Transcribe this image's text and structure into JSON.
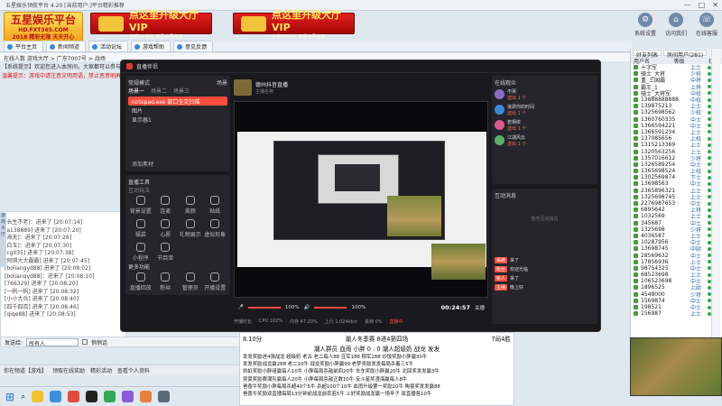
{
  "window": {
    "title": "五星娱乐领航平台 4.20 [当前用户:]平台精彩推荐",
    "controls": [
      "—",
      "□",
      "✕"
    ]
  },
  "logo": {
    "main": "五星娱乐平台",
    "url": "HD.FXT365.COM",
    "slogan": "2018 精彩无限 天天开心"
  },
  "banners": [
    {
      "title": "点这里升级大厅VIP",
      "sub": "全新VIP特权 尊贵会员专享"
    },
    {
      "title": "点这里升级大厅VIP",
      "sub": "全新VIP特权 尊贵会员专享"
    }
  ],
  "right_tools": [
    {
      "label": "系统设置",
      "icon": "gear-icon",
      "glyph": "⚙"
    },
    {
      "label": "访问我们",
      "icon": "home-icon",
      "glyph": "⌂"
    },
    {
      "label": "在线客服",
      "icon": "headset-icon",
      "glyph": "☏"
    }
  ],
  "nav": [
    "平台主页",
    "新闻频道",
    "活动论坛",
    "游戏帮助",
    "意见反馈"
  ],
  "crumb": "在线人数  游戏大厅 > 广东7007号 > 战场",
  "notice1": "【系统提示】欢迎您进入本房间，大家都可以参与游戏，本频道允许大家自由发言和交流，禁止发布广告",
  "notice2": "温馨提示：游戏中请注意文明用语，禁止恶意刷屏和辱骂他人，违者将被封号处理",
  "chat": [
    "[长生不老]：进来了 [20:07:14]",
    "[a138889] 进来了 [20:07:20]",
    "[海天]：进来了 [20:07:26]",
    "[白玉]：进来了 [20:07:30]",
    "[cg035] 进来了 [20:07:38]",
    "[阿琪大大霸霸] 进来了 [20:07:45]",
    "[boliangyd88] 进来了 [20:08:02]",
    "[boliangyd88]：进来了 [20:08:10]",
    "[766329] 进来了 [20:08:20]",
    "[一帆一帆] 进来了 [20:08:32]",
    "[小小大兵] 进来了 [20:08:40]",
    "[四千四百] 进来了 [20:08:46]",
    "[qiqe88] 进来了 [20:08:53]"
  ],
  "sidetab": "游戏大厅",
  "input": {
    "label": "发送给:",
    "target": "所有人",
    "checkbox": "悄悄话"
  },
  "statusbar": [
    "你在频道【游戏】",
    "领取在线奖励",
    "精彩活动",
    "查看个人资料"
  ],
  "rightpanel": {
    "tabs": [
      "好友列表",
      "房间用户(281)"
    ],
    "head": [
      "用户名",
      "等级",
      "状态"
    ],
    "users": [
      {
        "name": "十字军",
        "lv": "上士"
      },
      {
        "name": "骑士_大将",
        "lv": "少校"
      },
      {
        "name": "重_三国霸",
        "lv": "中将"
      },
      {
        "name": "霸王_1",
        "lv": "上将"
      },
      {
        "name": "骑士_大将军",
        "lv": "中校"
      },
      {
        "name": "13888888888",
        "lv": "中校"
      },
      {
        "name": "139875213",
        "lv": "上士"
      },
      {
        "name": "1325698562",
        "lv": "少校"
      },
      {
        "name": "1360760335",
        "lv": "中士"
      },
      {
        "name": "1366594221",
        "lv": "中士"
      },
      {
        "name": "1366591234",
        "lv": "上士"
      },
      {
        "name": "137085656",
        "lv": "上校"
      },
      {
        "name": "1315213369",
        "lv": "上士"
      },
      {
        "name": "1320563256",
        "lv": "上士"
      },
      {
        "name": "1357016612",
        "lv": "少将"
      },
      {
        "name": "1326589254",
        "lv": "中士"
      },
      {
        "name": "1365698524",
        "lv": "上校"
      },
      {
        "name": "1302569874",
        "lv": "下士"
      },
      {
        "name": "13698563",
        "lv": "中士"
      },
      {
        "name": "2365896321",
        "lv": "上士"
      },
      {
        "name": "1325698745",
        "lv": "上士"
      },
      {
        "name": "2276987653",
        "lv": "中士"
      },
      {
        "name": "6895642",
        "lv": "上将"
      },
      {
        "name": "1032569",
        "lv": "上士"
      },
      {
        "name": "345687",
        "lv": "中士"
      },
      {
        "name": "1325698",
        "lv": "少将"
      },
      {
        "name": "4036587",
        "lv": "上士"
      },
      {
        "name": "10287956",
        "lv": "中士"
      },
      {
        "name": "13698745",
        "lv": "中尉"
      },
      {
        "name": "28569632",
        "lv": "中士"
      },
      {
        "name": "17856936",
        "lv": "上士"
      },
      {
        "name": "98754325",
        "lv": "中士"
      },
      {
        "name": "68523698",
        "lv": "上士"
      },
      {
        "name": "106523698",
        "lv": "中士"
      },
      {
        "name": "1896525",
        "lv": "上尉"
      },
      {
        "name": "4548000",
        "lv": "少将"
      },
      {
        "name": "1569874",
        "lv": "中士"
      },
      {
        "name": "198521",
        "lv": "中士"
      },
      {
        "name": "156987",
        "lv": "上士"
      }
    ]
  },
  "obs": {
    "title": "直播伴侣",
    "scene_label": "常规模式",
    "scene_right": "场景",
    "source_tabs": [
      "场景一",
      "场景二",
      "场景三"
    ],
    "sources": [
      "notepad.exe 窗口全文扫描",
      "图片",
      "显示器1"
    ],
    "add_source": "添加素材",
    "tools_label": "直播工具",
    "tools_sub": "互动玩法",
    "tools": [
      "背景设置",
      "连麦",
      "美颜",
      "贴纸",
      "福袋",
      "心愿",
      "礼物展示",
      "虚拟形象",
      "小程序",
      "节目单"
    ],
    "more_label": "更多功能",
    "more": [
      "直播回放",
      "粉丝",
      "管理员",
      "开播设置"
    ],
    "channel": "德州抖音直播",
    "channel_sub": "主播名称",
    "controls": {
      "mic": "100%",
      "speaker": "100%",
      "time": "00:24:57",
      "end": "关播"
    },
    "stats": [
      "开播时长",
      "CPU 102%",
      "内存 47.20%",
      "上行 1,024kb/s",
      "丢帧 0%"
    ],
    "live_tag": "直播中",
    "audience_label": "在线观众",
    "audience": [
      {
        "name": "不哭",
        "sub": "送出 1 个"
      },
      {
        "name": "浪费你的时间",
        "sub": "送出 1 个"
      },
      {
        "name": "若相依",
        "sub": "送出 1 个"
      },
      {
        "name": "江湖风云",
        "sub": "送出 1 个"
      }
    ],
    "interact_label": "互动消息",
    "interact_empty": "暂无互动消息",
    "messages": [
      {
        "tag": "系统",
        "text": "来了"
      },
      {
        "tag": "粉丝",
        "text": "欢迎光临"
      },
      {
        "tag": "新人",
        "text": "来了"
      },
      {
        "tag": "主播",
        "text": "晚上好"
      }
    ]
  },
  "board": {
    "time": "8.10分",
    "title1": "潮人冬季赛 8进4第四场",
    "title1b": "7局4胜",
    "title2": "潮人群员 血雨 小胖 0 : 0 潮人超级奶 战龙 发发",
    "lines": [
      "发发奖励进4强战龙 超级奶 老古 老二每人88 豆军188 翔军288 炒饭奖励小胖赢30牛",
      "发发奖励战龙赢288 老二10牛 战龙奖励小胖赢99 老梦奖励发发每局杀着三5牛",
      "凯虹奖励小胖组赢每人10牛 小胖每局杀敌前四20牛 车车奖励小胖赢20牛 北回奖发发赢3牛",
      "吴豪奖励赛潮队赢每人20牛 小胖每局杀敌正数10牛 反斗星奖澄海赢每人8牛",
      "爸香牛奖励小胖每局杀超40个5牛 杀超100个10牛 血雨升级第一奖励10牛 陶豪奖发发赢88",
      "爸香牛奖励双直播每局13分钟前战龙前农若5牛    上好奖励战龙赢一场辛子 双直播各10牛"
    ]
  },
  "colors": {
    "accent": "#ff4d3d",
    "vip_red": "#d41616",
    "gold": "#ffd447"
  }
}
